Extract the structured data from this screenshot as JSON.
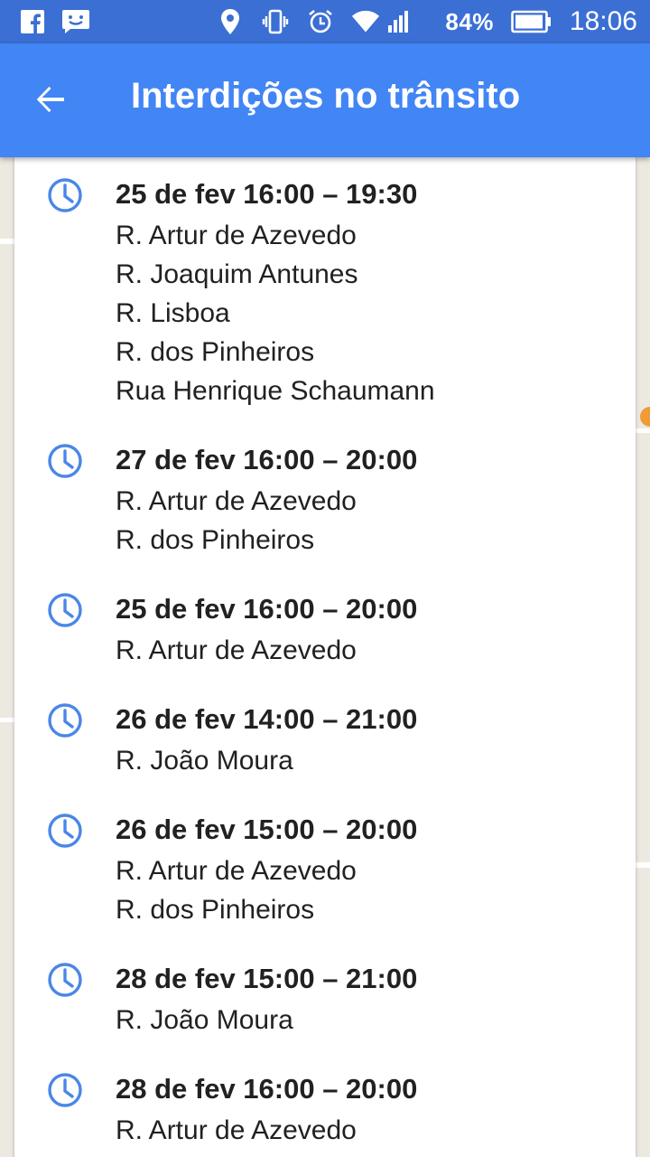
{
  "status_bar": {
    "battery": "84%",
    "time": "18:06",
    "icons": [
      "facebook-icon",
      "chat-icon",
      "location-icon",
      "vibrate-icon",
      "alarm-icon",
      "wifi-icon",
      "signal-icon",
      "battery-icon"
    ]
  },
  "app_bar": {
    "title": "Interdições no trânsito",
    "back_icon": "arrow-back-icon"
  },
  "colors": {
    "status_bar": "#3b6fd4",
    "app_bar": "#4285f4",
    "clock_icon": "#4a86e8",
    "text": "#212121"
  },
  "closures": [
    {
      "time": "25 de fev 16:00 – 19:30",
      "streets": [
        "R. Artur de Azevedo",
        "R. Joaquim Antunes",
        "R. Lisboa",
        "R. dos Pinheiros",
        "Rua Henrique Schaumann"
      ]
    },
    {
      "time": "27 de fev 16:00 – 20:00",
      "streets": [
        "R. Artur de Azevedo",
        "R. dos Pinheiros"
      ]
    },
    {
      "time": "25 de fev 16:00 – 20:00",
      "streets": [
        "R. Artur de Azevedo"
      ]
    },
    {
      "time": "26 de fev 14:00 – 21:00",
      "streets": [
        "R. João Moura"
      ]
    },
    {
      "time": "26 de fev 15:00 – 20:00",
      "streets": [
        "R. Artur de Azevedo",
        "R. dos Pinheiros"
      ]
    },
    {
      "time": "28 de fev 15:00 – 21:00",
      "streets": [
        "R. João Moura"
      ]
    },
    {
      "time": "28 de fev 16:00 – 20:00",
      "streets": [
        "R. Artur de Azevedo"
      ]
    }
  ]
}
